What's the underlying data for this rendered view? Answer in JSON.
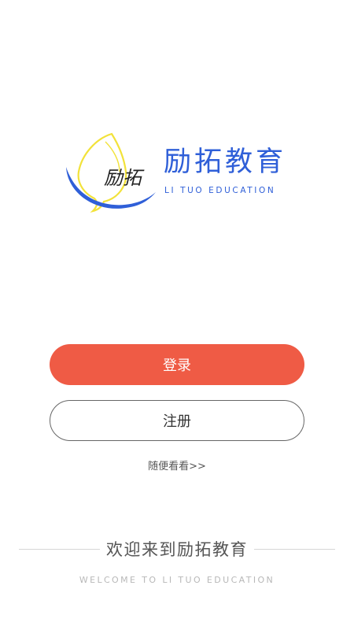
{
  "logo": {
    "icon": "fish-swoosh-logo-icon",
    "script_text": "励拓",
    "title": "励拓教育",
    "subtitle": "LI TUO EDUCATION",
    "colors": {
      "brand_blue": "#2f5fd8",
      "accent_yellow": "#f2e23a"
    }
  },
  "actions": {
    "login_label": "登录",
    "register_label": "注册",
    "browse_label": "随便看看>>"
  },
  "colors": {
    "login_bg": "#ef5b45",
    "register_border": "#666666",
    "background": "#ffffff"
  },
  "welcome": {
    "title": "欢迎来到励拓教育",
    "subtitle": "WELCOME TO LI TUO EDUCATION"
  }
}
